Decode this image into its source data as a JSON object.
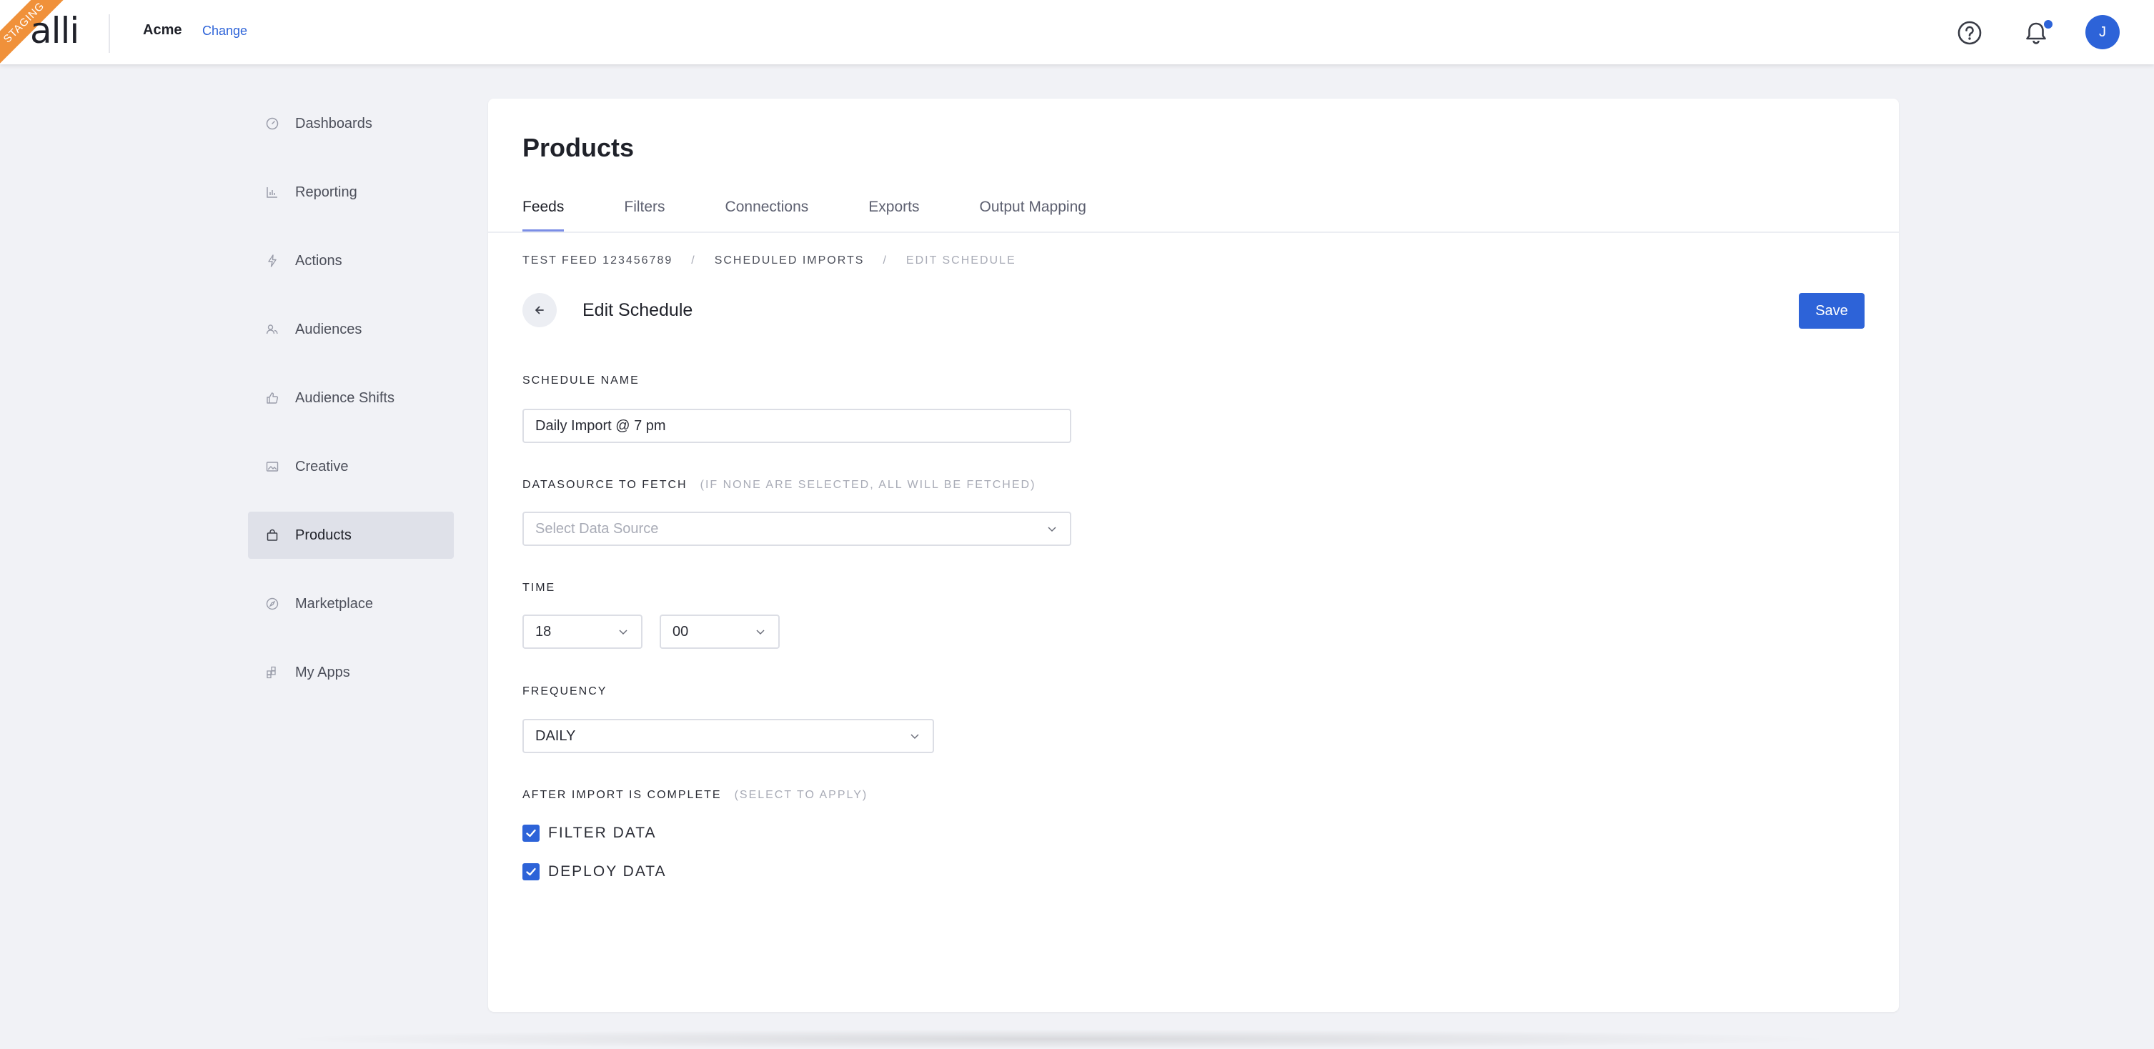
{
  "app": {
    "environment_badge": "STAGING",
    "logo_text": "alli",
    "org_name": "Acme",
    "org_change_label": "Change",
    "avatar_initial": "J",
    "accent_color": "#2d63d8",
    "badge_color": "#f0913a"
  },
  "sidebar": {
    "items": [
      {
        "label": "Dashboards",
        "icon": "gauge-icon"
      },
      {
        "label": "Reporting",
        "icon": "bar-chart-icon"
      },
      {
        "label": "Actions",
        "icon": "lightning-icon"
      },
      {
        "label": "Audiences",
        "icon": "people-icon"
      },
      {
        "label": "Audience Shifts",
        "icon": "thumb-icon"
      },
      {
        "label": "Creative",
        "icon": "image-icon"
      },
      {
        "label": "Products",
        "icon": "bag-icon",
        "active": true
      },
      {
        "label": "Marketplace",
        "icon": "compass-icon"
      },
      {
        "label": "My Apps",
        "icon": "apps-icon"
      }
    ]
  },
  "page": {
    "title": "Products",
    "tabs": [
      {
        "label": "Feeds",
        "active": true
      },
      {
        "label": "Filters"
      },
      {
        "label": "Connections"
      },
      {
        "label": "Exports"
      },
      {
        "label": "Output Mapping"
      }
    ],
    "breadcrumb": [
      "TEST FEED 123456789",
      "SCHEDULED IMPORTS",
      "EDIT SCHEDULE"
    ],
    "breadcrumb_separator": "/",
    "section_title": "Edit Schedule",
    "save_label": "Save"
  },
  "form": {
    "schedule_name_label": "SCHEDULE NAME",
    "schedule_name_value": "Daily Import @ 7 pm",
    "datasource_label": "DATASOURCE TO FETCH",
    "datasource_hint": "(IF NONE ARE SELECTED, ALL WILL BE FETCHED)",
    "datasource_placeholder": "Select Data Source",
    "time_label": "TIME",
    "time_hour": "18",
    "time_minute": "00",
    "frequency_label": "FREQUENCY",
    "frequency_value": "DAILY",
    "after_import_label": "AFTER IMPORT IS COMPLETE",
    "after_import_hint": "(SELECT TO APPLY)",
    "options": [
      {
        "label": "FILTER DATA",
        "checked": true
      },
      {
        "label": "DEPLOY DATA",
        "checked": true
      }
    ]
  }
}
